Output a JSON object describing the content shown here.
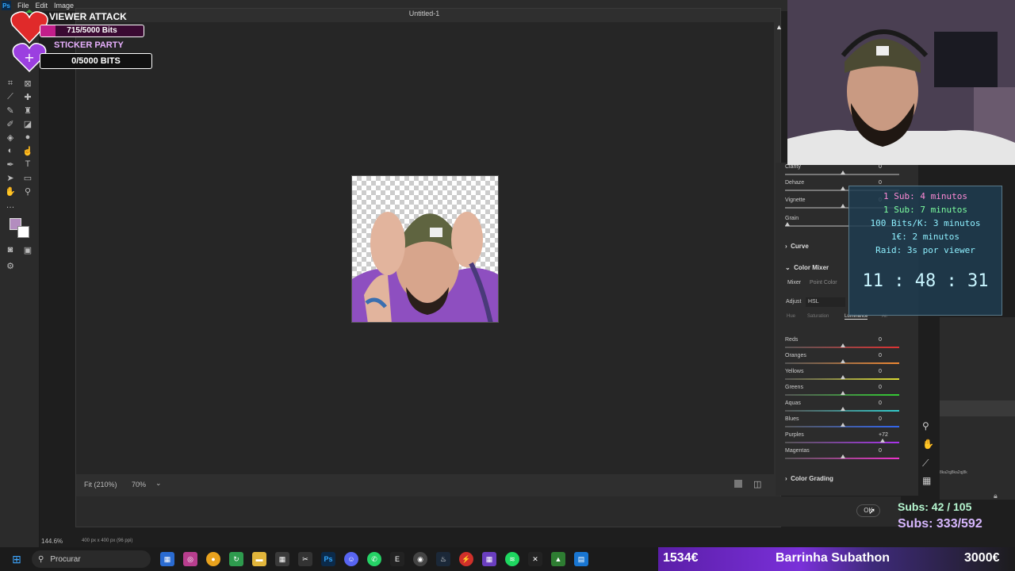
{
  "ps": {
    "logo": "Ps",
    "menu": [
      "File",
      "Edit",
      "Image"
    ],
    "status_zoom": "144.6%",
    "status_doc": "400 px x 400 px (96 ppi)"
  },
  "dialog": {
    "title": "Untitled-1",
    "fit_label": "Fit (210%)",
    "zoom_value": "70%",
    "ok_label": "OK"
  },
  "panel": {
    "top_sliders": [
      {
        "label": "Clarity",
        "value": "0"
      },
      {
        "label": "Dehaze",
        "value": "0"
      },
      {
        "label": "Vignette",
        "value": "0"
      },
      {
        "label": "Grain",
        "value": ""
      }
    ],
    "curve_label": "Curve",
    "color_mixer_label": "Color Mixer",
    "mixer_tabs": [
      "Mixer",
      "Point Color"
    ],
    "adjust_label": "Adjust",
    "adjust_value": "HSL",
    "hsl_tabs": [
      "Hue",
      "Saturation",
      "Luminance",
      "All"
    ],
    "color_sliders": [
      {
        "label": "Reds",
        "value": "0"
      },
      {
        "label": "Oranges",
        "value": "0"
      },
      {
        "label": "Yellows",
        "value": "0"
      },
      {
        "label": "Greens",
        "value": "0"
      },
      {
        "label": "Aquas",
        "value": "0"
      },
      {
        "label": "Blues",
        "value": "0"
      },
      {
        "label": "Purples",
        "value": "+72"
      },
      {
        "label": "Magentas",
        "value": "0"
      }
    ],
    "color_grading_label": "Color Grading",
    "far_right_text": "8ka2qj8ka2qj8k"
  },
  "alerts": {
    "viewer_attack_title": "VIEWER ATTACK",
    "viewer_attack_progress": "715/5000 Bits",
    "viewer_attack_fraction": 0.143,
    "sticker_party_title": "STICKER PARTY",
    "sticker_party_progress": "0/5000 BITS",
    "sticker_party_fraction": 0
  },
  "timer": {
    "lines": [
      "1 Sub: 4 minutos",
      "1 Sub: 7 minutos",
      "100 Bits/K: 3 minutos",
      "1€: 2 minutos",
      "Raid: 3s por viewer"
    ],
    "clock": "11 : 48 : 31"
  },
  "subs": {
    "line1": "Subs: 42 / 105",
    "line2": "Subs: 333/592"
  },
  "subathon": {
    "left_value": "1534€",
    "label": "Barrinha Subathon",
    "right_value": "3000€",
    "fill_fraction": 0.511
  },
  "taskbar": {
    "search_placeholder": "Procurar"
  }
}
